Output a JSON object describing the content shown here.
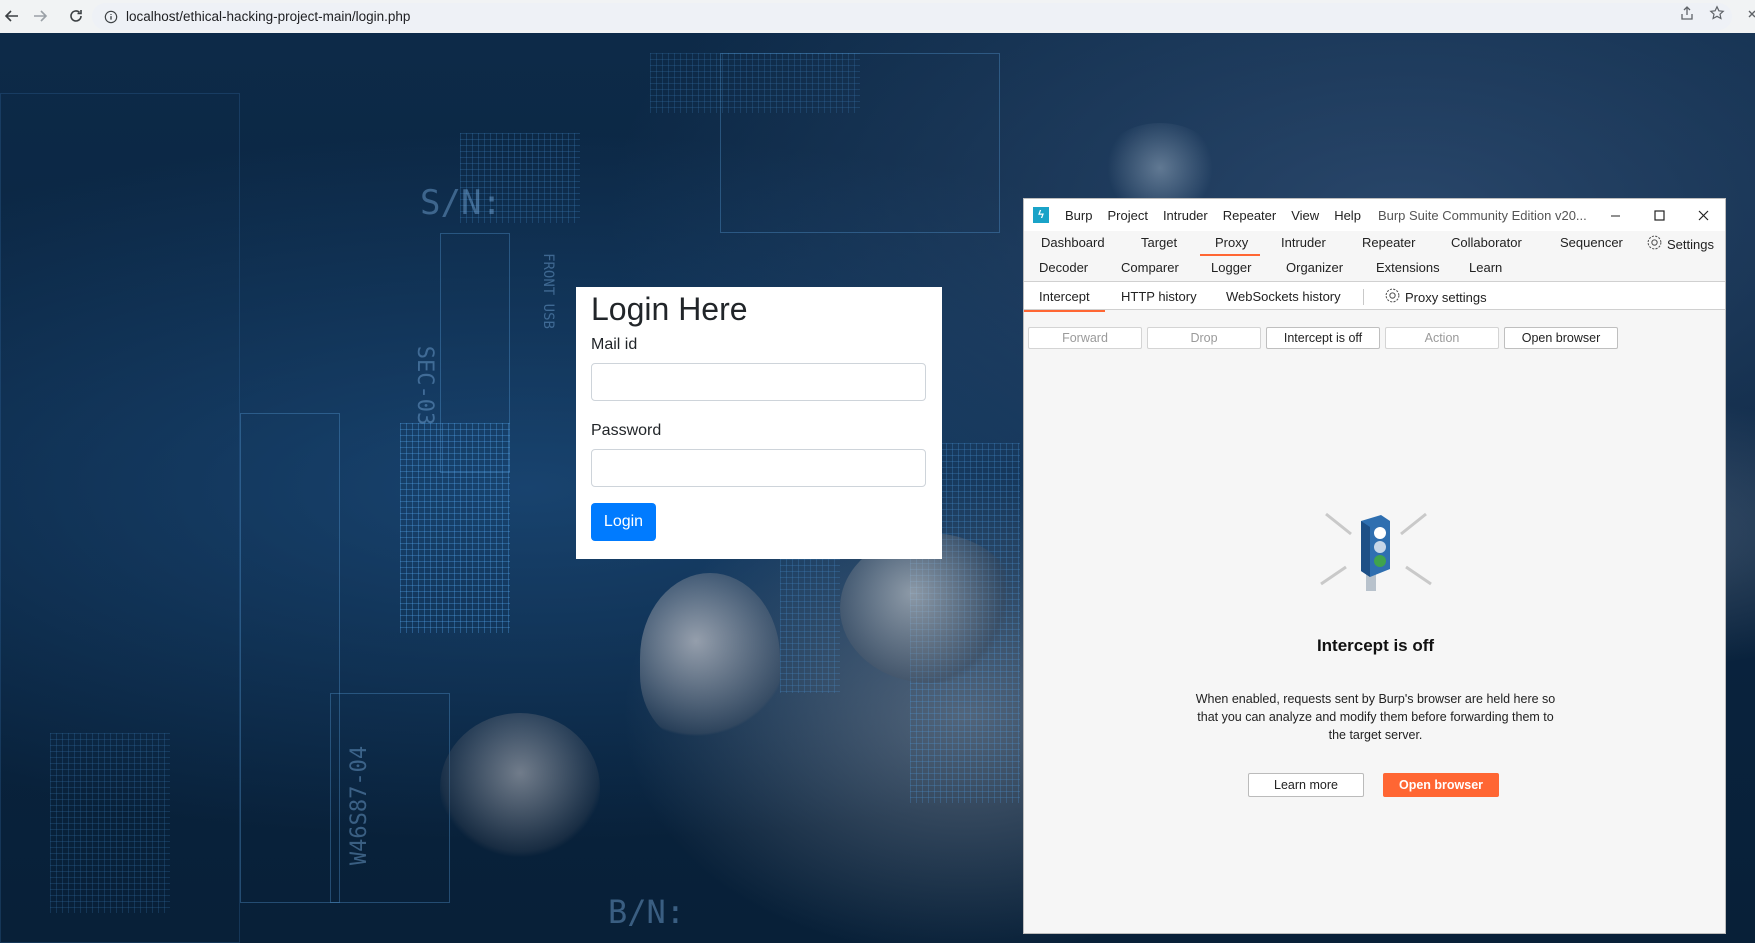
{
  "browser": {
    "url": "localhost/ethical-hacking-project-main/login.php"
  },
  "background_text": {
    "serial_top": "S/N:",
    "serial_bottom": "B/N:",
    "chip_code": "SEC-03",
    "part_code": "W46S87-04",
    "front_label": "FRONT USB"
  },
  "login": {
    "title": "Login Here",
    "mail_label": "Mail id",
    "mail_value": "",
    "password_label": "Password",
    "password_value": "",
    "submit_label": "Login",
    "button_color": "#007bff"
  },
  "burp": {
    "menu": [
      "Burp",
      "Project",
      "Intruder",
      "Repeater",
      "View",
      "Help"
    ],
    "window_title": "Burp Suite Community Edition v20...",
    "tabs_row1": [
      "Dashboard",
      "Target",
      "Proxy",
      "Intruder",
      "Repeater",
      "Collaborator",
      "Sequencer",
      "Settings"
    ],
    "tabs_row2": [
      "Decoder",
      "Comparer",
      "Logger",
      "Organizer",
      "Extensions",
      "Learn"
    ],
    "active_tab": "Proxy",
    "subtabs": [
      "Intercept",
      "HTTP history",
      "WebSockets history"
    ],
    "active_subtab": "Intercept",
    "proxy_settings_label": "Proxy settings",
    "actions": {
      "forward": "Forward",
      "drop": "Drop",
      "intercept_toggle": "Intercept is off",
      "action": "Action",
      "open_browser": "Open browser"
    },
    "empty_state": {
      "title": "Intercept is off",
      "description": "When enabled, requests sent by Burp's browser are held here so that you can analyze and modify them before forwarding them to the target server.",
      "learn_more": "Learn more",
      "open_browser": "Open browser"
    },
    "accent_color": "#ff6633"
  }
}
